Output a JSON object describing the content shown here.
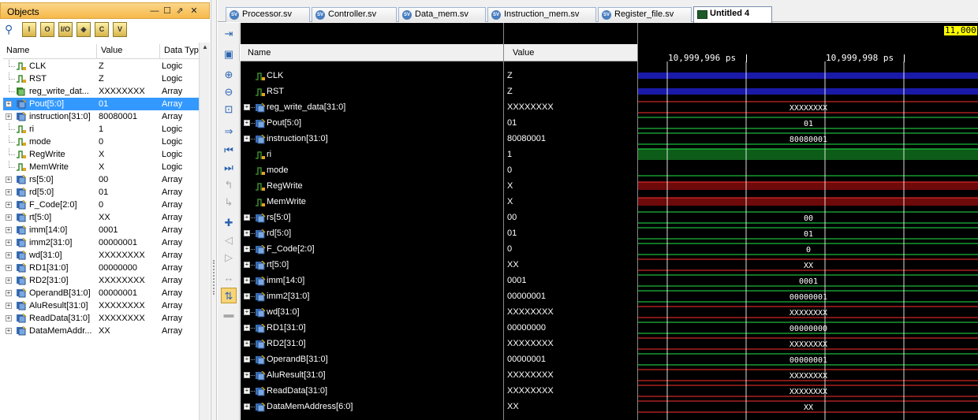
{
  "objects_panel": {
    "title": "Objects",
    "columns": {
      "name": "Name",
      "value": "Value",
      "type": "Data Typ"
    },
    "toolbar_labels": [
      "I",
      "O",
      "I/O",
      "◈",
      "C",
      "V"
    ],
    "rows": [
      {
        "name": "CLK",
        "value": "Z",
        "type": "Logic",
        "expandable": false,
        "kind": "logic"
      },
      {
        "name": "RST",
        "value": "Z",
        "type": "Logic",
        "expandable": false,
        "kind": "logic"
      },
      {
        "name": "reg_write_dat...",
        "value": "XXXXXXXX",
        "type": "Array",
        "expandable": false,
        "kind": "array-out"
      },
      {
        "name": "Pout[5:0]",
        "value": "01",
        "type": "Array",
        "expandable": true,
        "kind": "array",
        "selected": true
      },
      {
        "name": "instruction[31:0]",
        "value": "80080001",
        "type": "Array",
        "expandable": true,
        "kind": "array"
      },
      {
        "name": "ri",
        "value": "1",
        "type": "Logic",
        "expandable": false,
        "kind": "logic"
      },
      {
        "name": "mode",
        "value": "0",
        "type": "Logic",
        "expandable": false,
        "kind": "logic"
      },
      {
        "name": "RegWrite",
        "value": "X",
        "type": "Logic",
        "expandable": false,
        "kind": "logic"
      },
      {
        "name": "MemWrite",
        "value": "X",
        "type": "Logic",
        "expandable": false,
        "kind": "logic"
      },
      {
        "name": "rs[5:0]",
        "value": "00",
        "type": "Array",
        "expandable": true,
        "kind": "array"
      },
      {
        "name": "rd[5:0]",
        "value": "01",
        "type": "Array",
        "expandable": true,
        "kind": "array"
      },
      {
        "name": "F_Code[2:0]",
        "value": "0",
        "type": "Array",
        "expandable": true,
        "kind": "array"
      },
      {
        "name": "rt[5:0]",
        "value": "XX",
        "type": "Array",
        "expandable": true,
        "kind": "array"
      },
      {
        "name": "imm[14:0]",
        "value": "0001",
        "type": "Array",
        "expandable": true,
        "kind": "array"
      },
      {
        "name": "imm2[31:0]",
        "value": "00000001",
        "type": "Array",
        "expandable": true,
        "kind": "array"
      },
      {
        "name": "wd[31:0]",
        "value": "XXXXXXXX",
        "type": "Array",
        "expandable": true,
        "kind": "array"
      },
      {
        "name": "RD1[31:0]",
        "value": "00000000",
        "type": "Array",
        "expandable": true,
        "kind": "array"
      },
      {
        "name": "RD2[31:0]",
        "value": "XXXXXXXX",
        "type": "Array",
        "expandable": true,
        "kind": "array"
      },
      {
        "name": "OperandB[31:0]",
        "value": "00000001",
        "type": "Array",
        "expandable": true,
        "kind": "array"
      },
      {
        "name": "AluResult[31:0]",
        "value": "XXXXXXXX",
        "type": "Array",
        "expandable": true,
        "kind": "array"
      },
      {
        "name": "ReadData[31:0]",
        "value": "XXXXXXXX",
        "type": "Array",
        "expandable": true,
        "kind": "array"
      },
      {
        "name": "DataMemAddr...",
        "value": "XX",
        "type": "Array",
        "expandable": true,
        "kind": "array"
      }
    ]
  },
  "tabs": [
    {
      "label": "Processor.sv",
      "active": false,
      "icon": "sv"
    },
    {
      "label": "Controller.sv",
      "active": false,
      "icon": "sv"
    },
    {
      "label": "Data_mem.sv",
      "active": false,
      "icon": "sv"
    },
    {
      "label": "Instruction_mem.sv",
      "active": false,
      "icon": "sv"
    },
    {
      "label": "Register_file.sv",
      "active": false,
      "icon": "sv"
    },
    {
      "label": "Untitled 4",
      "active": true,
      "icon": "wave"
    }
  ],
  "wave": {
    "name_header": "Name",
    "value_header": "Value",
    "cursor_label": "11,000",
    "ticks": [
      "10,999,996 ps",
      "10,999,998 ps"
    ],
    "signals": [
      {
        "name": "CLK",
        "value": "Z",
        "kind": "logic",
        "expandable": false,
        "style": "blue",
        "label": ""
      },
      {
        "name": "RST",
        "value": "Z",
        "kind": "logic",
        "expandable": false,
        "style": "blue",
        "label": ""
      },
      {
        "name": "reg_write_data[31:0]",
        "value": "XXXXXXXX",
        "kind": "array",
        "expandable": true,
        "style": "bus-red",
        "label": "XXXXXXXX"
      },
      {
        "name": "Pout[5:0]",
        "value": "01",
        "kind": "array",
        "expandable": true,
        "style": "bus-green",
        "label": "01"
      },
      {
        "name": "instruction[31:0]",
        "value": "80080001",
        "kind": "array",
        "expandable": true,
        "style": "bus-green",
        "label": "80080001"
      },
      {
        "name": "ri",
        "value": "1",
        "kind": "logic",
        "expandable": false,
        "style": "high",
        "label": ""
      },
      {
        "name": "mode",
        "value": "0",
        "kind": "logic",
        "expandable": false,
        "style": "low",
        "label": ""
      },
      {
        "name": "RegWrite",
        "value": "X",
        "kind": "logic",
        "expandable": false,
        "style": "x-red",
        "label": ""
      },
      {
        "name": "MemWrite",
        "value": "X",
        "kind": "logic",
        "expandable": false,
        "style": "x-red",
        "label": ""
      },
      {
        "name": "rs[5:0]",
        "value": "00",
        "kind": "array",
        "expandable": true,
        "style": "bus-green",
        "label": "00"
      },
      {
        "name": "rd[5:0]",
        "value": "01",
        "kind": "array",
        "expandable": true,
        "style": "bus-green",
        "label": "01"
      },
      {
        "name": "F_Code[2:0]",
        "value": "0",
        "kind": "array",
        "expandable": true,
        "style": "bus-green",
        "label": "0"
      },
      {
        "name": "rt[5:0]",
        "value": "XX",
        "kind": "array",
        "expandable": true,
        "style": "bus-red",
        "label": "XX"
      },
      {
        "name": "imm[14:0]",
        "value": "0001",
        "kind": "array",
        "expandable": true,
        "style": "bus-green",
        "label": "0001"
      },
      {
        "name": "imm2[31:0]",
        "value": "00000001",
        "kind": "array",
        "expandable": true,
        "style": "bus-green",
        "label": "00000001"
      },
      {
        "name": "wd[31:0]",
        "value": "XXXXXXXX",
        "kind": "array",
        "expandable": true,
        "style": "bus-red",
        "label": "XXXXXXXX"
      },
      {
        "name": "RD1[31:0]",
        "value": "00000000",
        "kind": "array",
        "expandable": true,
        "style": "bus-green",
        "label": "00000000"
      },
      {
        "name": "RD2[31:0]",
        "value": "XXXXXXXX",
        "kind": "array",
        "expandable": true,
        "style": "bus-red",
        "label": "XXXXXXXX"
      },
      {
        "name": "OperandB[31:0]",
        "value": "00000001",
        "kind": "array",
        "expandable": true,
        "style": "bus-green",
        "label": "00000001"
      },
      {
        "name": "AluResult[31:0]",
        "value": "XXXXXXXX",
        "kind": "array",
        "expandable": true,
        "style": "bus-red",
        "label": "XXXXXXXX"
      },
      {
        "name": "ReadData[31:0]",
        "value": "XXXXXXXX",
        "kind": "array",
        "expandable": true,
        "style": "bus-red",
        "label": "XXXXXXXX"
      },
      {
        "name": "DataMemAddress[6:0]",
        "value": "XX",
        "kind": "array",
        "expandable": true,
        "style": "bus-red",
        "label": "XX"
      }
    ]
  },
  "colors": {
    "wave_green": "#22e64a",
    "wave_red": "#ff3030",
    "wave_blue": "#1a1aa8",
    "high_fill": "#0d5c18",
    "x_fill": "#6e0a0a",
    "cursor": "#ffff00",
    "selection": "#3399ff",
    "panel_title": "#f6b94a"
  }
}
